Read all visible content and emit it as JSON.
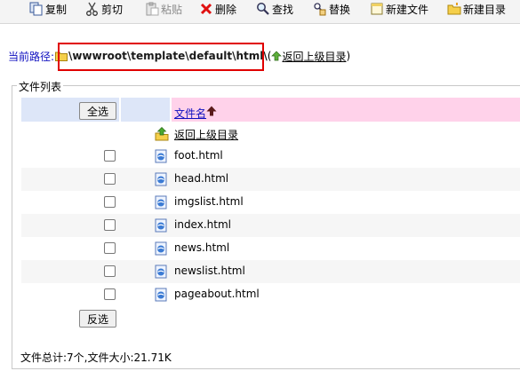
{
  "toolbar": {
    "copy": "复制",
    "cut": "剪切",
    "paste": "粘贴",
    "delete": "删除",
    "find": "查找",
    "replace": "替换",
    "new_file": "新建文件",
    "new_dir": "新建目录"
  },
  "path": {
    "label": "当前路径:",
    "value": "\\wwwroot\\template\\default\\html\\",
    "up_link": "返回上级目录",
    "open_paren": "(",
    "close_paren": ")"
  },
  "file_list": {
    "legend": "文件列表",
    "select_all": "全选",
    "invert_select": "反选",
    "col_filename": "文件名",
    "up_dir": "返回上级目录",
    "files": [
      "foot.html",
      "head.html",
      "imgslist.html",
      "index.html",
      "news.html",
      "newslist.html",
      "pageabout.html"
    ]
  },
  "footer": {
    "summary": "文件总计:7个,文件大小:21.71K"
  },
  "colors": {
    "header_blue": "#dde6f8",
    "header_pink": "#ffd2ea",
    "link_blue": "#1010c0",
    "highlight_red": "#e00000"
  }
}
